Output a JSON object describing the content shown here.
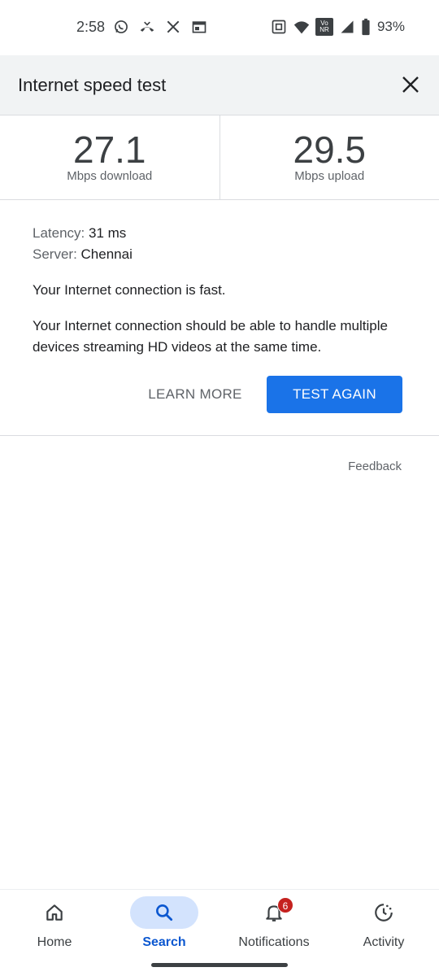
{
  "status_bar": {
    "time": "2:58",
    "battery": "93%",
    "left_icons": [
      "whatsapp-icon",
      "missed-call-icon",
      "x-icon",
      "calendar-icon"
    ],
    "right_icons": [
      "nfc-icon",
      "wifi-icon",
      "vonr-icon",
      "signal-icon",
      "battery-icon"
    ],
    "vonr_label_top": "Vo",
    "vonr_label_bottom": "NR"
  },
  "header": {
    "title": "Internet speed test",
    "close_icon": "close-icon"
  },
  "speed": {
    "download_value": "27.1",
    "download_unit": "Mbps download",
    "upload_value": "29.5",
    "upload_unit": "Mbps upload"
  },
  "details": {
    "latency_key": "Latency:",
    "latency_value": "31 ms",
    "server_key": "Server:",
    "server_value": "Chennai",
    "message_fast": "Your Internet connection is fast.",
    "message_desc": "Your Internet connection should be able to handle multiple devices streaming HD videos at the same time."
  },
  "actions": {
    "learn_more": "LEARN MORE",
    "test_again": "TEST AGAIN"
  },
  "feedback": "Feedback",
  "bottom_nav": {
    "items": [
      {
        "label": "Home",
        "icon": "home-icon"
      },
      {
        "label": "Search",
        "icon": "search-icon",
        "active": true
      },
      {
        "label": "Notifications",
        "icon": "bell-icon",
        "badge": "6"
      },
      {
        "label": "Activity",
        "icon": "activity-icon"
      }
    ]
  },
  "colors": {
    "accent": "#1a73e8",
    "active_nav": "#0b57d0",
    "active_pill": "#d3e3fd",
    "badge": "#c5221f",
    "header_bg": "#f1f3f4"
  }
}
